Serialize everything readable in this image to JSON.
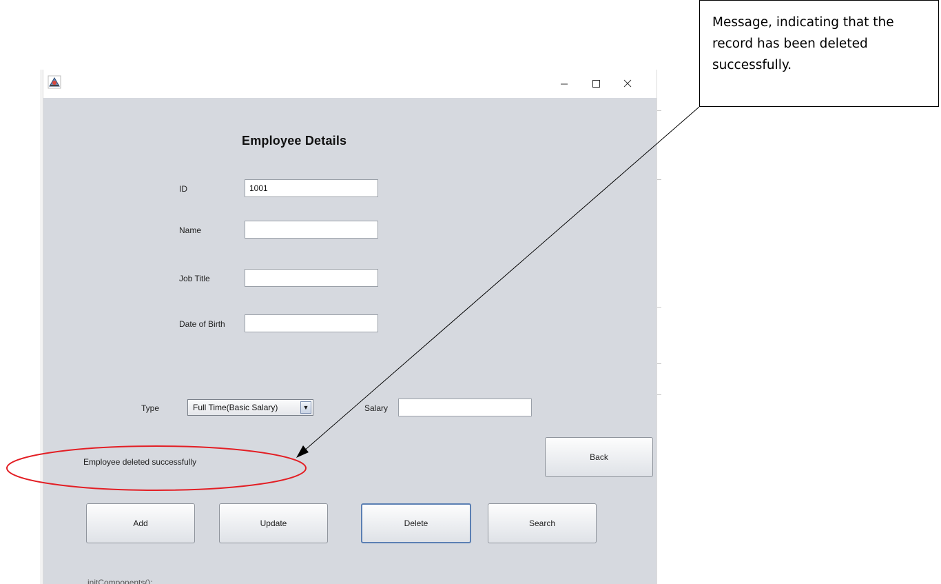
{
  "window": {
    "title": "",
    "controls": {
      "minimize": "—",
      "maximize": "☐",
      "close": "✕"
    }
  },
  "form": {
    "title": "Employee Details",
    "fields": {
      "id": {
        "label": "ID",
        "value": "1001"
      },
      "name": {
        "label": "Name",
        "value": ""
      },
      "job_title": {
        "label": "Job Title",
        "value": ""
      },
      "date_of_birth": {
        "label": "Date of Birth",
        "value": ""
      }
    },
    "type": {
      "label": "Type",
      "selected": "Full Time(Basic Salary)",
      "arrow": "▼"
    },
    "salary": {
      "label": "Salary",
      "value": ""
    },
    "status_message": "Employee deleted successfully"
  },
  "buttons": {
    "back": "Back",
    "add": "Add",
    "update": "Update",
    "delete": "Delete",
    "search": "Search"
  },
  "annotation": {
    "callout_text": "Message, indicating that the record has been deleted successfully.",
    "highlight_color": "#e31e24",
    "arrow_color": "#000000"
  },
  "background": {
    "bottom_fragment_text": "initComponents();"
  }
}
